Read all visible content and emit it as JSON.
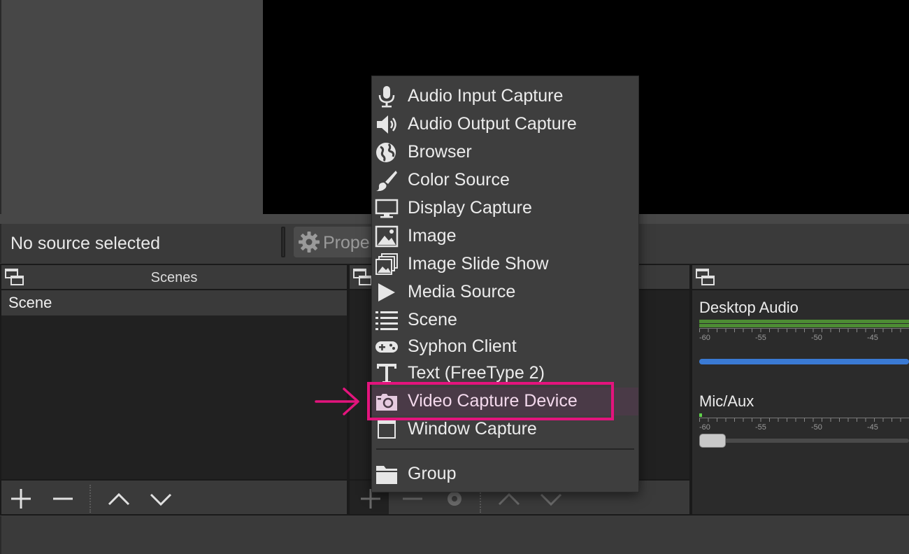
{
  "source_bar": {
    "no_source_text": "No source selected",
    "properties_label": "Prope"
  },
  "docks": {
    "scenes": {
      "title": "Scenes",
      "items": [
        "Scene"
      ]
    },
    "sources": {
      "title": ""
    },
    "audio_mixer": {
      "title": "",
      "tracks": [
        {
          "name": "Desktop Audio",
          "level": 1.0,
          "volume": 1.0
        },
        {
          "name": "Mic/Aux",
          "level": 0.0,
          "volume": 0.0
        }
      ],
      "tick_labels": [
        "-60",
        "-55",
        "-50",
        "-45"
      ]
    }
  },
  "context_menu": {
    "items": [
      {
        "label": "Audio Input Capture",
        "icon": "microphone-icon"
      },
      {
        "label": "Audio Output Capture",
        "icon": "speaker-icon"
      },
      {
        "label": "Browser",
        "icon": "globe-icon"
      },
      {
        "label": "Color Source",
        "icon": "brush-icon"
      },
      {
        "label": "Display Capture",
        "icon": "monitor-icon"
      },
      {
        "label": "Image",
        "icon": "image-icon"
      },
      {
        "label": "Image Slide Show",
        "icon": "slideshow-icon"
      },
      {
        "label": "Media Source",
        "icon": "play-icon"
      },
      {
        "label": "Scene",
        "icon": "list-icon"
      },
      {
        "label": "Syphon Client",
        "icon": "gamepad-icon"
      },
      {
        "label": "Text (FreeType 2)",
        "icon": "text-icon"
      },
      {
        "label": "Video Capture Device",
        "icon": "camera-icon",
        "highlighted": true
      },
      {
        "label": "Window Capture",
        "icon": "window-icon"
      },
      {
        "label": "Group",
        "icon": "folder-icon"
      }
    ]
  },
  "colors": {
    "highlight_border": "#e3147d",
    "meter_green": "#4d8c34",
    "volume_blue": "#3a7ad4"
  }
}
